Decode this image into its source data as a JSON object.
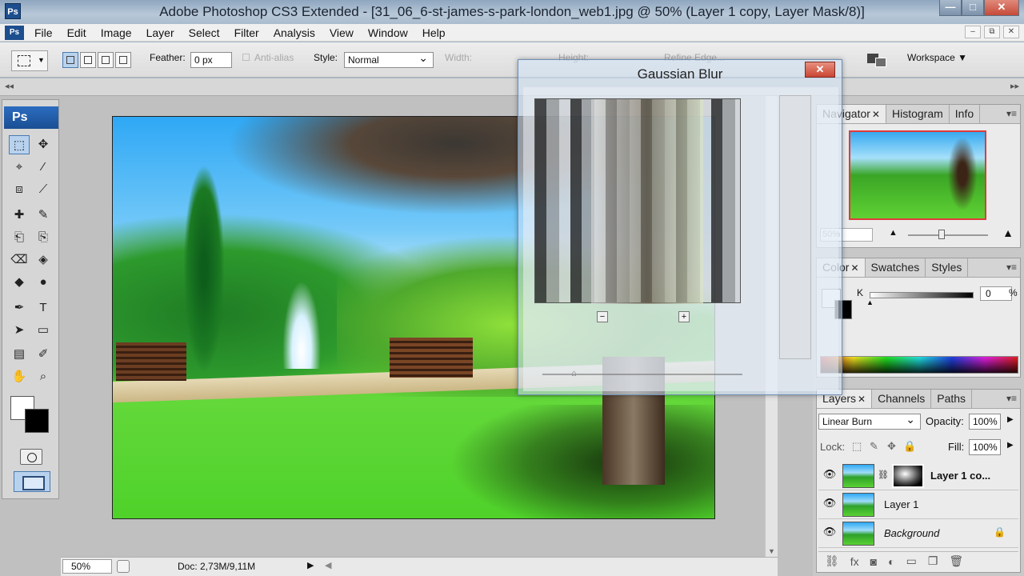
{
  "window": {
    "title": "Adobe Photoshop CS3 Extended - [31_06_6-st-james-s-park-london_web1.jpg @ 50% (Layer 1 copy, Layer Mask/8)]",
    "app_icon": "Ps",
    "controls": {
      "minimize": "—",
      "maximize": "□",
      "close": "✕"
    }
  },
  "menubar": {
    "logo": "Ps",
    "items": [
      "File",
      "Edit",
      "Image",
      "Layer",
      "Select",
      "Filter",
      "Analysis",
      "View",
      "Window",
      "Help"
    ],
    "doc_controls": [
      "–",
      "⧉",
      "✕"
    ]
  },
  "options": {
    "feather_label": "Feather:",
    "feather_value": "0 px",
    "antialias_label": "Anti-alias",
    "style_label": "Style:",
    "style_value": "Normal",
    "width_label": "Width:",
    "height_label": "Height:",
    "refine_label": "Refine Edge...",
    "workspace_label": "Workspace ▼"
  },
  "toolbox": {
    "badge": "Ps",
    "tools": [
      "⬚",
      "✥",
      "⌖",
      "⁄",
      "⧈",
      "⟋",
      "✚",
      "✎",
      "⎗",
      "⎘",
      "⌫",
      "◈",
      "◆",
      "●",
      "✒",
      "T",
      "➤",
      "▭",
      "▤",
      "✐",
      "✋",
      "⌕"
    ]
  },
  "dialog": {
    "title": "Gaussian Blur",
    "close": "✕",
    "zoom_out": "−",
    "zoom_in": "+"
  },
  "status": {
    "zoom": "50%",
    "doc": "Doc: 2,73M/9,11M"
  },
  "navigator_panel": {
    "tabs": [
      "Navigator",
      "Histogram",
      "Info"
    ],
    "zoom": "50%"
  },
  "color_panel": {
    "tabs": [
      "Color",
      "Swatches",
      "Styles"
    ],
    "k_label": "K",
    "k_value": "0",
    "k_unit": "%"
  },
  "layers_panel": {
    "tabs": [
      "Layers",
      "Channels",
      "Paths"
    ],
    "blend_mode": "Linear Burn",
    "opacity_label": "Opacity:",
    "opacity_value": "100%",
    "lock_label": "Lock:",
    "fill_label": "Fill:",
    "fill_value": "100%",
    "layers": [
      {
        "name": "Layer 1 co...",
        "selected": true,
        "has_mask": true
      },
      {
        "name": "Layer 1",
        "selected": false
      },
      {
        "name": "Background",
        "selected": false,
        "locked": true
      }
    ]
  },
  "colors": {
    "accent": "#3b8ee0",
    "titlebar": "#a9bbce",
    "close_button": "#c94532"
  }
}
